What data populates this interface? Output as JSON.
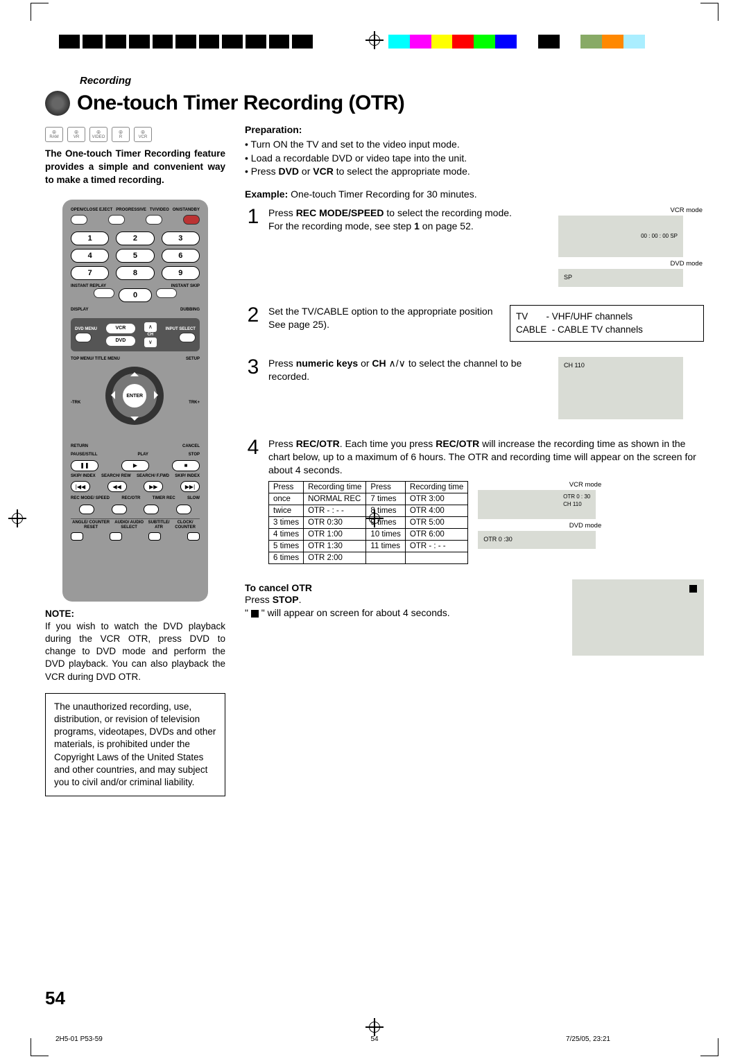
{
  "section": "Recording",
  "title": "One-touch Timer Recording (OTR)",
  "format_icons": [
    "RAM",
    "VR",
    "VIDEO",
    "R",
    "VCR"
  ],
  "intro": "The One-touch Timer Recording feature provides a simple and convenient way to make a timed recording.",
  "remote": {
    "top_labels": [
      "OPEN/CLOSE EJECT",
      "PROGRESSIVE",
      "TV/VIDEO",
      "ON/STANDBY"
    ],
    "numpad": [
      "1",
      "2",
      "3",
      "4",
      "5",
      "6",
      "7",
      "8",
      "9",
      "0"
    ],
    "instant_left": "INSTANT REPLAY",
    "instant_right": "INSTANT SKIP",
    "display": "DISPLAY",
    "dubbing": "DUBBING",
    "vcr": "VCR",
    "dvd": "DVD",
    "ch": "CH",
    "dvd_menu": "DVD MENU",
    "input_select": "INPUT SELECT",
    "top_menu": "TOP MENU/ TITLE MENU",
    "setup": "SETUP",
    "trk_minus": "-TRK",
    "enter": "ENTER",
    "trk_plus": "TRK+",
    "return": "RETURN",
    "cancel": "CANCEL",
    "pause": "PAUSE/STILL",
    "play": "PLAY",
    "stop": "STOP",
    "transport": [
      "SKIP/ INDEX",
      "SEARCH/ REW",
      "SEARCH/ F.FWD",
      "SKIP/ INDEX"
    ],
    "rec_row": [
      "REC MODE/ SPEED",
      "REC/OTR",
      "TIMER REC",
      "SLOW"
    ],
    "bottom_labels": [
      "ANGLE/ COUNTER RESET",
      "AUDIO/ AUDIO SELECT",
      "SUBTITLE/ ATR",
      "CLOCK/ COUNTER"
    ]
  },
  "note_hd": "NOTE:",
  "note_txt": "If you wish to watch the DVD playback during the VCR OTR, press DVD to change to DVD mode and perform the DVD playback. You can also playback the VCR during DVD OTR.",
  "legal": "The unauthorized recording, use, distribution, or revision of television programs, videotapes, DVDs and other materials, is prohibited under the Copyright Laws of the United States and other countries, and may subject you to civil and/or criminal liability.",
  "prep_hd": "Preparation:",
  "prep_bullets": [
    "Turn ON the TV and set to the video input mode.",
    "Load a recordable DVD or video tape into the unit.",
    "Press DVD or VCR to select the appropriate mode."
  ],
  "example_pre": "Example:",
  "example_txt": " One-touch Timer Recording for 30 minutes.",
  "steps": {
    "s1a": "Press ",
    "s1b": "REC MODE/SPEED",
    "s1c": " to select the recording mode.",
    "s1d": "For the recording mode, see step ",
    "s1e": "1",
    "s1f": " on page 52.",
    "s2": "Set the TV/CABLE option to the appropriate position See page 25).",
    "s3a": "Press ",
    "s3b": "numeric keys",
    "s3c": " or ",
    "s3d": "CH ",
    "s3e": " to select the channel to be recorded.",
    "s4a": "Press ",
    "s4b": "REC/OTR",
    "s4c": ". Each time you press ",
    "s4d": "REC/OTR",
    "s4e": " will increase the recording time as shown in the chart below, up to a maximum of 6 hours. The OTR and recording time will appear on the screen for about 4 seconds."
  },
  "screen1_vcr_lbl": "VCR mode",
  "screen1_vcr_txt": "00 : 00 : 00  SP",
  "screen1_dvd_lbl": "DVD mode",
  "screen1_dvd_txt": "SP",
  "chan_box": {
    "tv": "TV",
    "tv_desc": "- VHF/UHF channels",
    "cable": "CABLE",
    "cable_desc": "- CABLE TV channels"
  },
  "screen3_txt": "CH  110",
  "otr_table": {
    "headers": [
      "Press",
      "Recording time",
      "Press",
      "Recording time"
    ],
    "rows": [
      [
        "once",
        "NORMAL REC",
        "7 times",
        "OTR 3:00"
      ],
      [
        "twice",
        "OTR - : - -",
        "8 times",
        "OTR 4:00"
      ],
      [
        "3 times",
        "OTR 0:30",
        "9 times",
        "OTR 5:00"
      ],
      [
        "4 times",
        "OTR 1:00",
        "10 times",
        "OTR 6:00"
      ],
      [
        "5 times",
        "OTR 1:30",
        "11 times",
        "OTR - : - -"
      ],
      [
        "6 times",
        "OTR 2:00",
        "",
        ""
      ]
    ]
  },
  "screen4_vcr_lbl": "VCR mode",
  "screen4_vcr_l1": "OTR  0 : 30",
  "screen4_vcr_l2": "CH 110",
  "screen4_dvd_lbl": "DVD mode",
  "screen4_dvd_txt": "OTR  0 :30",
  "cancel_hd": "To cancel OTR",
  "cancel_a": "Press ",
  "cancel_b": "STOP",
  "cancel_c": ".",
  "cancel_d": "\" ",
  "cancel_e": " \" will appear on screen for about 4 seconds.",
  "page_number": "54",
  "slug_left": "2H5-01 P53-59",
  "slug_center": "54",
  "slug_right": "7/25/05, 23:21",
  "colorbar": [
    "#0ff",
    "#f0f",
    "#ff0",
    "#f00",
    "#0f0",
    "#00f",
    "#fff",
    "#000",
    "#fff",
    "#8a6",
    "#f80",
    "#aef"
  ]
}
